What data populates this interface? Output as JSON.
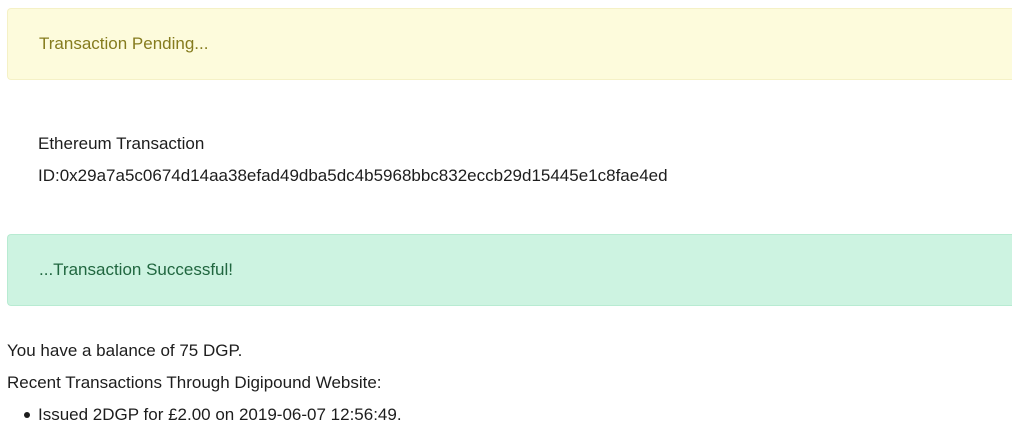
{
  "alerts": {
    "pending": "Transaction Pending...",
    "success": "...Transaction Successful!"
  },
  "transaction": {
    "label": "Ethereum Transaction",
    "id_text": "ID:0x29a7a5c0674d14aa38efad49dba5dc4b5968bbc832eccb29d15445e1c8fae4ed"
  },
  "account": {
    "balance_text": "You have a balance of 75 DGP.",
    "recent_heading": "Recent Transactions Through Digipound Website:",
    "recent_items": [
      "Issued 2DGP for £2.00 on 2019-06-07 12:56:49."
    ]
  },
  "colors": {
    "pending_bg": "#fdfbdc",
    "pending_text": "#857b1e",
    "success_bg": "#cdf3e1",
    "success_text": "#20663f"
  }
}
